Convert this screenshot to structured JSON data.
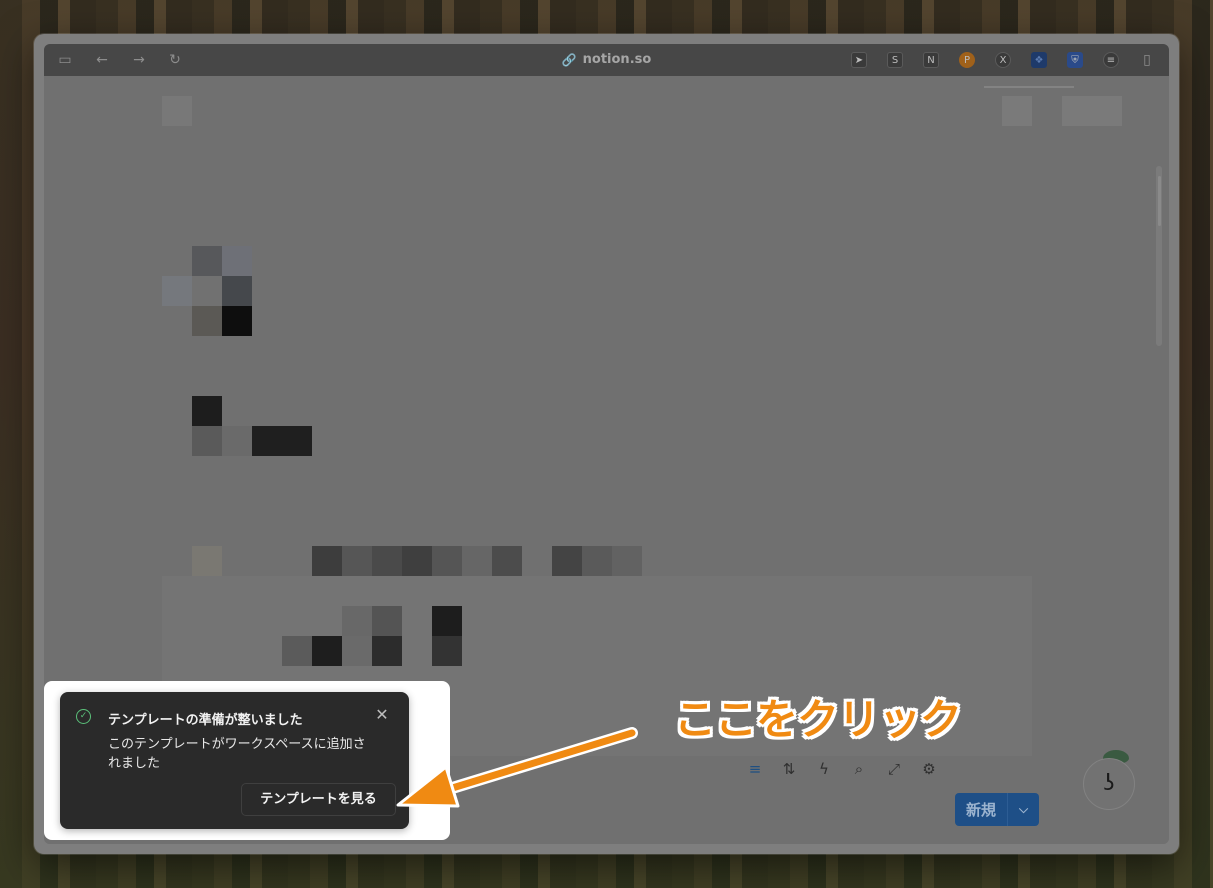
{
  "browser": {
    "url": "notion.so",
    "extensions": [
      "paper-plane",
      "S",
      "N",
      "P",
      "X",
      "❖",
      "shield",
      "list"
    ]
  },
  "database_toolbar": {
    "new_label": "新規",
    "icons": [
      "filter-icon",
      "sort-icon",
      "automation-icon",
      "search-icon",
      "expand-icon",
      "settings-icon"
    ]
  },
  "toast": {
    "title": "テンプレートの準備が整いました",
    "body": "このテンプレートがワークスペースに追加されました",
    "button_label": "テンプレートを見る",
    "close_glyph": "✕"
  },
  "annotation": {
    "text": "ここをクリック",
    "color": "#f08a12"
  }
}
